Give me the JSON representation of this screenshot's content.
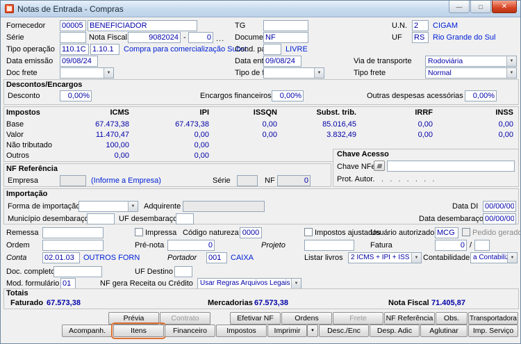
{
  "window": {
    "title": "Notas de Entrada - Compras"
  },
  "icons": {
    "dropdown_arrow": "▼",
    "minimize": "—",
    "maximize": "□",
    "close": "✕",
    "browse_dots": "...",
    "chave_nfe_icon": "▦"
  },
  "fields": {
    "fornecedor_label": "Fornecedor",
    "fornecedor_code": "00005",
    "fornecedor_name": "BENEFICIADOR",
    "tg_label": "TG",
    "tg_value": "",
    "un_label": "U.N.",
    "un_value": "2",
    "un_name": "CIGAM",
    "serie_label": "Série",
    "serie_value": "",
    "nota_fiscal_label": "Nota Fiscal",
    "nota_fiscal_value": "9082024",
    "nota_fiscal_sep": "-",
    "nota_fiscal_sub": "0",
    "documento_label": "Documento",
    "documento_value": "NF",
    "uf_label": "UF",
    "uf_value": "RS",
    "uf_name": "Rio Grande do Sul",
    "tipo_operacao_label": "Tipo operação",
    "tipo_operacao_code1": "110.1C",
    "tipo_operacao_code2": "1.10.1",
    "tipo_operacao_desc": "Compra para comercialização Subst.",
    "cond_pag_label": "Cond. pag.",
    "cond_pag_value": "",
    "cond_pag_desc": "LIVRE",
    "data_emissao_label": "Data emissão",
    "data_emissao_value": "09/08/24",
    "data_entrada_label": "Data entrada",
    "data_entrada_value": "09/08/24",
    "via_transporte_label": "Via de transporte",
    "via_transporte_value": "Rodoviária",
    "doc_frete_label": "Doc frete",
    "doc_frete_value": "",
    "tipo_de_frete_label": "Tipo de frete",
    "tipo_de_frete_value": "",
    "tipo_frete_label": "Tipo frete",
    "tipo_frete_value": "Normal"
  },
  "descontos": {
    "title": "Descontos/Encargos",
    "desconto_label": "Desconto",
    "desconto_value": "0,00%",
    "encargos_label": "Encargos financeiros",
    "encargos_value": "0,00%",
    "outras_label": "Outras despesas acessórias",
    "outras_value": "0,00%"
  },
  "impostos": {
    "title": "Impostos",
    "columns": [
      "ICMS",
      "IPI",
      "ISSQN",
      "Subst. trib.",
      "IRRF",
      "INSS"
    ],
    "rows": [
      {
        "label": "Base",
        "values": [
          "67.473,38",
          "67.473,38",
          "0,00",
          "85.016,45",
          "0,00",
          "0,00"
        ]
      },
      {
        "label": "Valor",
        "values": [
          "11.470,47",
          "0,00",
          "0,00",
          "3.832,49",
          "0,00",
          "0,00"
        ]
      },
      {
        "label": "Não tributado",
        "values": [
          "100,00",
          "0,00",
          "",
          "",
          "",
          ""
        ]
      },
      {
        "label": "Outros",
        "values": [
          "0,00",
          "0,00",
          "",
          "",
          "",
          ""
        ]
      }
    ]
  },
  "chave": {
    "title": "Chave Acesso",
    "chave_nfe_label": "Chave NFe",
    "chave_nfe_value": "",
    "prot_autor_label": "Prot. Autor.",
    "prot_autor_value": ".   .   .   .   .   .   ."
  },
  "nf_ref": {
    "title": "NF Referência",
    "empresa_label": "Empresa",
    "empresa_value": "",
    "empresa_hint": "(Informe a Empresa)",
    "serie_label": "Série",
    "serie_value": "",
    "nf_label": "NF",
    "nf_value": "0"
  },
  "importacao": {
    "title": "Importação",
    "forma_label": "Forma de importação",
    "forma_value": "",
    "adquirente_label": "Adquirente",
    "adquirente_value": "",
    "data_di_label": "Data DI",
    "data_di_value": "00/00/00",
    "municipio_label": "Município desembaraço",
    "municipio_value": "",
    "uf_desembaraco_label": "UF desembaraço",
    "uf_desembaraco_value": "",
    "data_desembaraco_label": "Data desembaraço",
    "data_desembaraco_value": "00/00/00"
  },
  "detalhes": {
    "remessa_label": "Remessa",
    "remessa_value": "",
    "impressa_label": "Impressa",
    "codigo_natureza_label": "Código natureza",
    "codigo_natureza_value": "0000",
    "impostos_ajustados_label": "Impostos ajustados",
    "usuario_autorizado_label": "Usuário autorizado",
    "usuario_autorizado_value": "MCG",
    "pedido_gerado_label": "Pedido gerado",
    "ordem_label": "Ordem",
    "ordem_value": "",
    "pre_nota_label": "Pré-nota",
    "pre_nota_value": "0",
    "projeto_label": "Projeto",
    "projeto_value": "",
    "fatura_label": "Fatura",
    "fatura_value": "0",
    "fatura_sep": "/",
    "fatura_value2": "",
    "conta_label": "Conta",
    "conta_value": "02.01.03",
    "conta_desc": "OUTROS FORN",
    "portador_label": "Portador",
    "portador_value": "001",
    "portador_desc": "CAIXA",
    "listar_livros_label": "Listar livros",
    "listar_livros_value": "2 ICMS + IPI + ISS",
    "contabilidade_label": "Contabilidade",
    "contabilidade_value": "a Contabilizar",
    "doc_completo_label": "Doc. completo",
    "doc_completo_value": "",
    "uf_destino_label": "UF Destino",
    "uf_destino_value": "",
    "mod_formulario_label": "Mod. formulário",
    "mod_formulario_value": "01",
    "nf_gera_label": "NF gera Receita ou Crédito",
    "nf_gera_value": "Usar Regras Arquivos Legais"
  },
  "totais": {
    "title": "Totais",
    "faturado_label": "Faturado",
    "faturado_value": "67.573,38",
    "mercadorias_label": "Mercadorias",
    "mercadorias_value": "67.573,38",
    "nota_fiscal_label": "Nota Fiscal",
    "nota_fiscal_value": "71.405,87"
  },
  "buttons": {
    "row1": [
      "Prévia",
      "Contrato",
      "Efetivar NF",
      "Ordens",
      "Frete",
      "NF Referência",
      "Obs.",
      "Transportadora"
    ],
    "row2": [
      "Acompanh.",
      "Itens",
      "Financeiro",
      "Impostos",
      "Imprimir",
      "Desc./Enc",
      "Desp. Adic",
      "Aglutinar",
      "Imp. Serviço"
    ]
  }
}
